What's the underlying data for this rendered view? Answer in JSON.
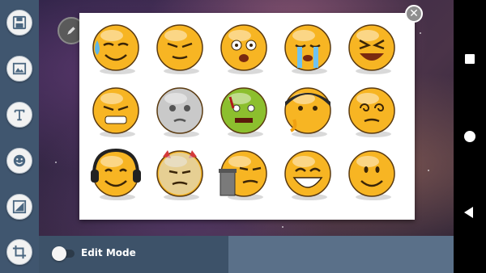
{
  "toolbar": {
    "items": [
      {
        "name": "save",
        "icon": "floppy-disk-icon"
      },
      {
        "name": "image",
        "icon": "image-icon"
      },
      {
        "name": "text",
        "icon": "text-icon"
      },
      {
        "name": "sticker",
        "icon": "smiley-icon"
      },
      {
        "name": "frame",
        "icon": "frame-icon"
      },
      {
        "name": "crop",
        "icon": "crop-icon"
      }
    ]
  },
  "edit_mode": {
    "label": "Edit Mode",
    "enabled": false
  },
  "picker": {
    "close_icon": "close-icon",
    "stickers": [
      {
        "name": "sweat-smile",
        "color": "#f7b523"
      },
      {
        "name": "squint-wink",
        "color": "#f7b523"
      },
      {
        "name": "shocked",
        "color": "#f7b523"
      },
      {
        "name": "crying",
        "color": "#f7b523"
      },
      {
        "name": "laughing-xd",
        "color": "#f7b523"
      },
      {
        "name": "grimace",
        "color": "#f7b523"
      },
      {
        "name": "ghost-grey",
        "color": "#c9c9c9"
      },
      {
        "name": "zombie-green",
        "color": "#8cbf2e"
      },
      {
        "name": "masked-drool",
        "color": "#f7b523"
      },
      {
        "name": "dizzy",
        "color": "#f7b523"
      },
      {
        "name": "headphones",
        "color": "#f7b523"
      },
      {
        "name": "devil-bandaged",
        "color": "#f7b523"
      },
      {
        "name": "trash-can",
        "color": "#f7b523"
      },
      {
        "name": "big-grin",
        "color": "#f7b523"
      },
      {
        "name": "smile",
        "color": "#f7b523"
      }
    ]
  },
  "nav": {
    "recent_icon": "square-icon",
    "home_icon": "circle-icon",
    "back_icon": "back-triangle-icon"
  }
}
